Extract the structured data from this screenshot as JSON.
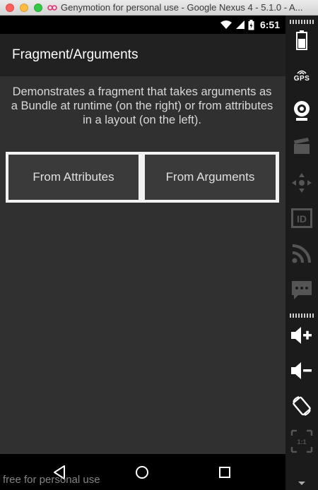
{
  "window": {
    "title": "Genymotion for personal use - Google Nexus 4 - 5.1.0 - A..."
  },
  "status_bar": {
    "time": "6:51"
  },
  "action_bar": {
    "title": "Fragment/Arguments"
  },
  "main": {
    "description": "Demonstrates a fragment that takes arguments as a Bundle at runtime (on the right) or from attributes in a layout (on the left).",
    "fragments": [
      {
        "label": "From Attributes"
      },
      {
        "label": "From Arguments"
      }
    ]
  },
  "nav_bar": {
    "watermark": "free for personal use",
    "buttons": [
      "back-icon",
      "home-icon",
      "recents-icon"
    ]
  },
  "sidebar": {
    "gps_label": "GPS",
    "id_label": "ID",
    "pixel_label": "1:1",
    "items": [
      "battery-icon",
      "gps-icon",
      "webcam-icon",
      "clapperboard-icon",
      "dpad-icon",
      "id-icon",
      "rss-icon",
      "chat-icon",
      "volume-up-icon",
      "volume-down-icon",
      "rotate-icon",
      "pixel-perfect-icon"
    ]
  },
  "colors": {
    "screen_bg": "#303030",
    "action_bar_bg": "#212121",
    "status_bar_bg": "#000000",
    "sidebar_bg": "#1b1b1b"
  }
}
